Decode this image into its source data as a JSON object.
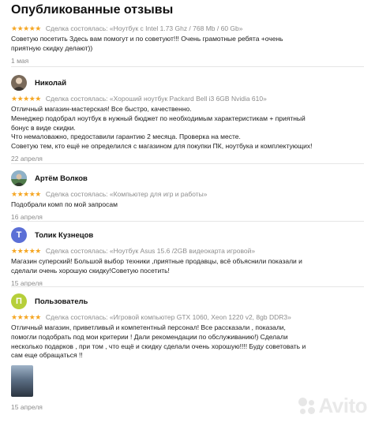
{
  "page_title": "Опубликованные отзывы",
  "stars_text": "★★★★★",
  "reviews": [
    {
      "avatar_letter": "",
      "avatar_color": "",
      "author": "",
      "deal": "Сделка состоялась: «Ноутбук с Intel 1.73 Ghz / 768 Mb / 60 Gb»",
      "text": "Советую посетить Здесь вам помогут и по советуют!!! Очень грамотные ребята +очень\nприятную скидку делают))",
      "date": "1 мая"
    },
    {
      "avatar_letter": "",
      "avatar_color": "#7a6a5a",
      "author": "Николай",
      "deal": "Сделка состоялась: «Хороший ноутбук Packard Bell i3 6GB Nvidia 610»",
      "text": "Отличный магазин-мастерская! Все быстро, качественно.\nМенеджер подобрал ноутбук в нужный бюджет по необходимым характеристикам + приятный\nбонус в виде скидки.\nЧто немаловажно, предоставили гарантию 2 месяца. Проверка на месте.\nСоветую тем, кто ещё не определился с магазином для покупки ПК, ноутбука и комплектующих!",
      "date": "22 апреля"
    },
    {
      "avatar_letter": "",
      "avatar_color": "#4f7a4a",
      "author": "Артём Волков",
      "deal": "Сделка состоялась: «Компьютер для игр и работы»",
      "text": "Подобрали комп по мой запросам",
      "date": "16 апреля"
    },
    {
      "avatar_letter": "Т",
      "avatar_color": "#5b6fd6",
      "author": "Толик Кузнецов",
      "deal": "Сделка состоялась: «Ноутбук Asus 15.6 /2GB видеокарта игровой»",
      "text": "Магазин суперский! Большой выбор техники ,приятные продавцы, всё объяснили показали и\nсделали очень хорошую скидку!Советую посетить!",
      "date": "15 апреля"
    },
    {
      "avatar_letter": "П",
      "avatar_color": "#b6cf3a",
      "author": "Пользователь",
      "deal": "Сделка состоялась: «Игровой компьютер GTX 1060, Xeon 1220 v2, 8gb DDR3»",
      "text": "Отличный магазин, приветливый и компетентный персонал! Все рассказали , показали,\nпомогли подобрать под мои критерии ! Дали рекомендации по обслуживанию!) Сделали\nнесколько подарков , при том , что ещё и скидку сделали очень хорошую!!!! Буду советовать и\nсам еще обращаться !!",
      "date": "15 апреля"
    }
  ],
  "watermark": "Avito"
}
